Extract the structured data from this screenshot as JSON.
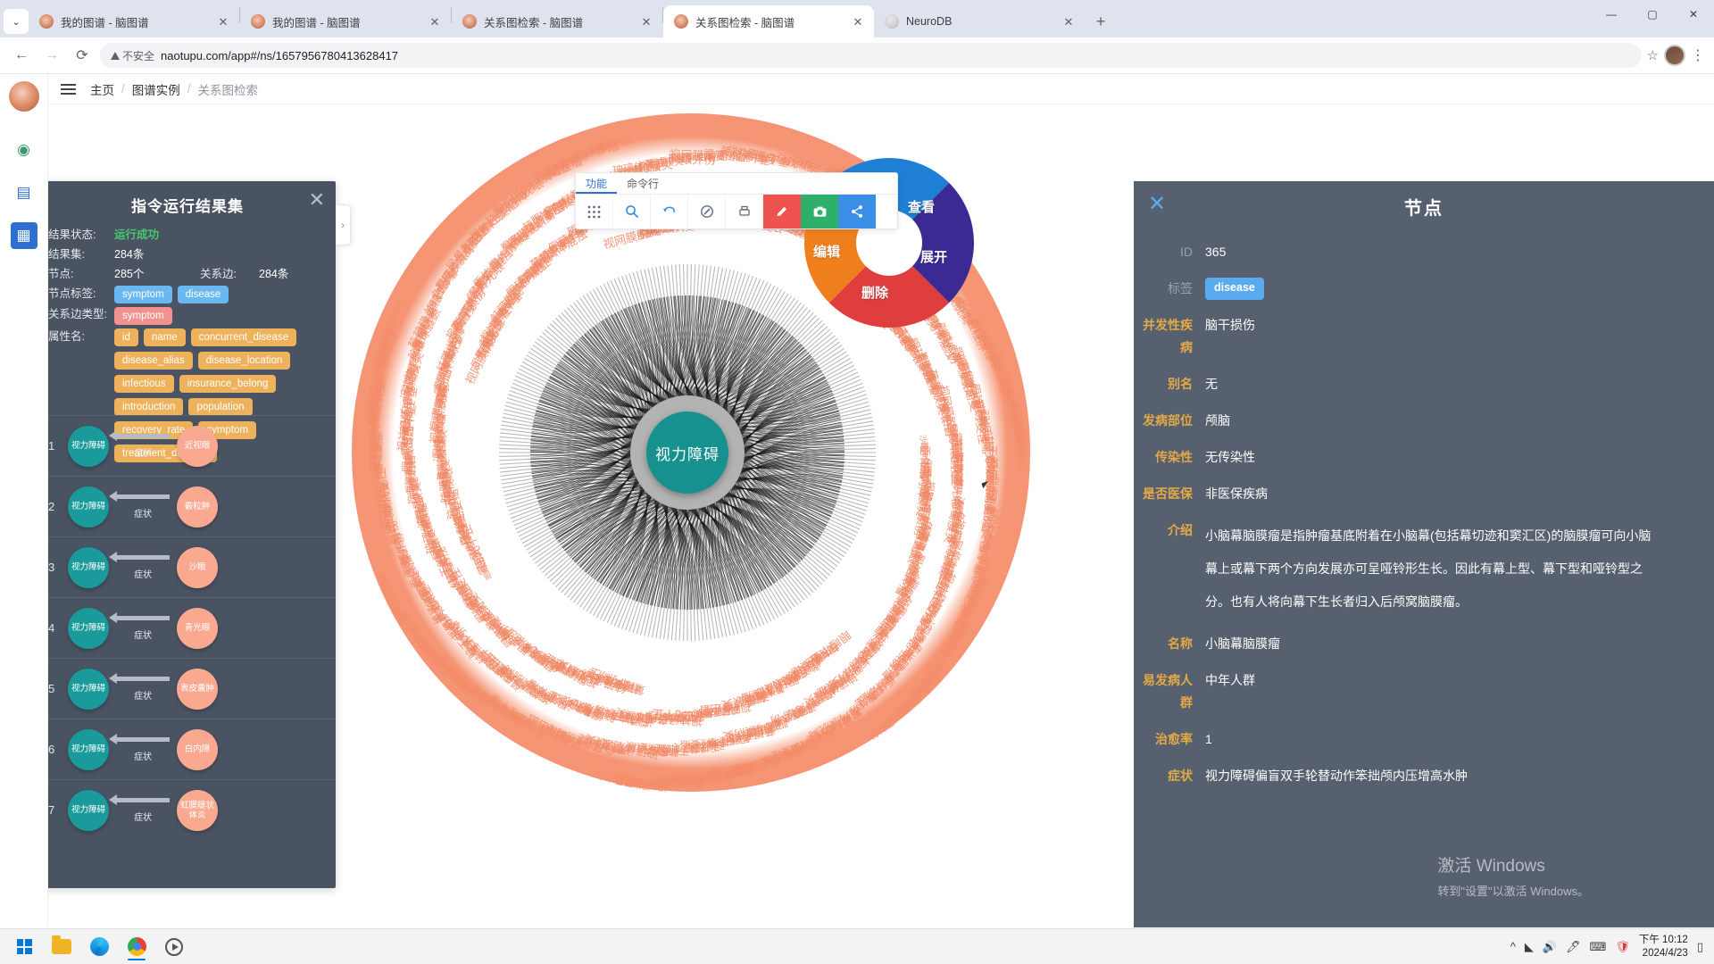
{
  "browser": {
    "tabs": [
      {
        "title": "我的图谱 - 脑图谱",
        "active": false,
        "favicon": "brain-icon"
      },
      {
        "title": "我的图谱 - 脑图谱",
        "active": false,
        "favicon": "brain-icon"
      },
      {
        "title": "关系图检索 - 脑图谱",
        "active": false,
        "favicon": "brain-icon"
      },
      {
        "title": "关系图检索 - 脑图谱",
        "active": true,
        "favicon": "brain-icon"
      },
      {
        "title": "NeuroDB",
        "active": false,
        "favicon": "neuro-icon"
      }
    ],
    "new_tab_label": "+",
    "tab_close_label": "✕",
    "tablist_chevron": "⌄",
    "window_controls": {
      "minimize": "—",
      "maximize": "▢",
      "close": "✕"
    },
    "nav": {
      "back": "←",
      "forward": "→",
      "reload": "⟳"
    },
    "security_label": "不安全",
    "url": "naotupu.com/app#/ns/1657956780413628417",
    "star": "☆",
    "menu": "⋮"
  },
  "app": {
    "breadcrumb": {
      "home": "主页",
      "sep": "/",
      "level2": "图谱实例",
      "current": "关系图检索"
    }
  },
  "result_panel": {
    "title": "指令运行结果集",
    "close_label": "✕",
    "handle_label": "›",
    "fields": {
      "status_label": "结果状态:",
      "status_value": "运行成功",
      "resultset_label": "结果集:",
      "resultset_value": "284条",
      "nodes_label": "节点:",
      "nodes_value": "285个",
      "edges_label": "关系边:",
      "edges_value": "284条",
      "node_labels_label": "节点标签:",
      "edge_type_label": "关系边类型:",
      "attrs_label": "属性名:"
    },
    "node_labels": [
      "symptom",
      "disease"
    ],
    "edge_types": [
      "symptom"
    ],
    "attributes": [
      "id",
      "name",
      "concurrent_disease",
      "disease_alias",
      "disease_location",
      "infectious",
      "insurance_belong",
      "introduction",
      "population",
      "recovery_rate",
      "symptom",
      "treatment_duration"
    ],
    "items": [
      {
        "index": "1",
        "source": "视力障碍",
        "edge": "症状",
        "target": "近视眼"
      },
      {
        "index": "2",
        "source": "视力障碍",
        "edge": "症状",
        "target": "霰粒肿"
      },
      {
        "index": "3",
        "source": "视力障碍",
        "edge": "症状",
        "target": "沙眼"
      },
      {
        "index": "4",
        "source": "视力障碍",
        "edge": "症状",
        "target": "青光眼"
      },
      {
        "index": "5",
        "source": "视力障碍",
        "edge": "症状",
        "target": "表皮囊肿"
      },
      {
        "index": "6",
        "source": "视力障碍",
        "edge": "症状",
        "target": "白内障"
      },
      {
        "index": "7",
        "source": "视力障碍",
        "edge": "症状",
        "target": "虹膜睫状体炎"
      }
    ]
  },
  "graph_toolbar": {
    "tabs": [
      {
        "label": "功能",
        "active": true
      },
      {
        "label": "命令行",
        "active": false
      }
    ],
    "buttons": [
      {
        "name": "grid-layout-icon",
        "glyph": "▦"
      },
      {
        "name": "search-icon",
        "glyph": "🔍"
      },
      {
        "name": "undo-icon",
        "glyph": "↩"
      },
      {
        "name": "link-icon",
        "glyph": "🔗"
      },
      {
        "name": "print-icon",
        "glyph": "🖨"
      },
      {
        "name": "edit-icon",
        "glyph": "✎",
        "color": "#ef5350"
      },
      {
        "name": "camera-icon",
        "glyph": "📷",
        "color": "#2eaf6a"
      },
      {
        "name": "share-icon",
        "glyph": "⌁",
        "color": "#3a8ee6"
      }
    ]
  },
  "radial_menu": {
    "items": [
      {
        "label": "查看",
        "color": "#1e7fd4"
      },
      {
        "label": "展开",
        "color": "#3c2a94"
      },
      {
        "label": "删除",
        "color": "#e03e3e"
      },
      {
        "label": "编辑",
        "color": "#f0801e"
      }
    ]
  },
  "graph": {
    "center_node_label": "视力障碍",
    "colors": {
      "center": "#16918f",
      "halo": "#f0876a",
      "spoke": "#b5b5b5",
      "inner": "#1a1a1a"
    }
  },
  "node_panel": {
    "close_label": "✕",
    "title": "节点",
    "rows": [
      {
        "key": "ID",
        "value": "365",
        "key_style": "gray",
        "type": "text"
      },
      {
        "key": "标签",
        "value": "disease",
        "key_style": "gray",
        "type": "tag"
      },
      {
        "key": "并发性疾病",
        "value": "脑干损伤",
        "key_style": "gold",
        "type": "text"
      },
      {
        "key": "别名",
        "value": "无",
        "key_style": "gold",
        "type": "text"
      },
      {
        "key": "发病部位",
        "value": "颅脑",
        "key_style": "gold",
        "type": "text"
      },
      {
        "key": "传染性",
        "value": "无传染性",
        "key_style": "gold",
        "type": "text"
      },
      {
        "key": "是否医保",
        "value": "非医保疾病",
        "key_style": "gold",
        "type": "text"
      },
      {
        "key": "介绍",
        "value": "小脑幕脑膜瘤是指肿瘤基底附着在小脑幕(包括幕切迹和窦汇区)的脑膜瘤可向小脑幕上或幕下两个方向发展亦可呈哑铃形生长。因此有幕上型、幕下型和哑铃型之分。也有人将向幕下生长者归入后颅窝脑膜瘤。",
        "key_style": "gold",
        "type": "para"
      },
      {
        "key": "名称",
        "value": "小脑幕脑膜瘤",
        "key_style": "gold",
        "type": "text"
      },
      {
        "key": "易发病人群",
        "value": "中年人群",
        "key_style": "gold",
        "type": "text"
      },
      {
        "key": "治愈率",
        "value": "1",
        "key_style": "gold",
        "type": "text"
      },
      {
        "key": "症状",
        "value": "视力障碍偏盲双手轮替动作笨拙颅内压增高水肿",
        "key_style": "gold",
        "type": "text"
      }
    ]
  },
  "watermark": {
    "line1": "激活 Windows",
    "line2": "转到\"设置\"以激活 Windows。"
  },
  "taskbar": {
    "icons": [
      {
        "name": "start-icon"
      },
      {
        "name": "file-explorer-icon"
      },
      {
        "name": "edge-icon"
      },
      {
        "name": "chrome-icon"
      },
      {
        "name": "media-player-icon"
      }
    ],
    "tray": {
      "chevron": "^",
      "network": "◣",
      "volume": "🔊",
      "pen": "🖊",
      "keyboard": "⌨",
      "shield": "🛡",
      "hide": "∧"
    },
    "clock": {
      "time": "下午 10:12",
      "date": "2024/4/23"
    }
  }
}
